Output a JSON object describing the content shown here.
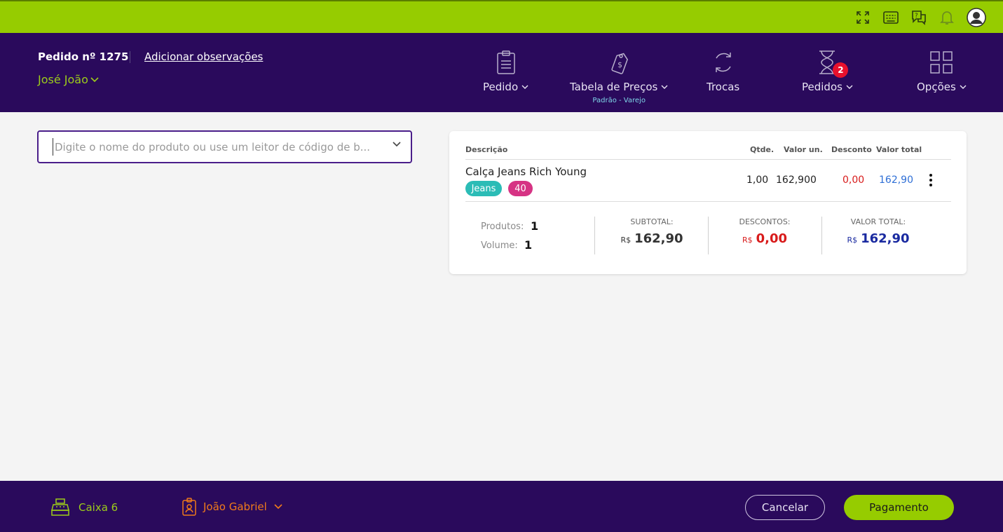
{
  "topbar": {
    "icons": [
      "fullscreen-icon",
      "keyboard-icon",
      "help-chat-icon",
      "bell-icon",
      "user-avatar-icon"
    ]
  },
  "header": {
    "order_number": "Pedido nº 1275",
    "add_notes_link": "Adicionar observações",
    "customer_name": "José João",
    "nav": [
      {
        "label": "Pedido",
        "icon": "clipboard-icon"
      },
      {
        "label": "Tabela de Preços",
        "sublabel": "Padrão - Varejo",
        "icon": "price-tag-icon"
      },
      {
        "label": "Trocas",
        "icon": "exchange-icon"
      },
      {
        "label": "Pedidos",
        "badge": "2",
        "icon": "hourglass-icon"
      },
      {
        "label": "Opções",
        "icon": "grid-icon"
      }
    ]
  },
  "search": {
    "placeholder": "Digite o nome do produto ou use um leitor de código de b...",
    "value": ""
  },
  "cart": {
    "columns": [
      "Descrição",
      "Qtde.",
      "Valor un.",
      "Desconto",
      "Valor total"
    ],
    "items": [
      {
        "description": "Calça Jeans Rich Young",
        "tags": [
          "Jeans",
          "40"
        ],
        "qty": "1,00",
        "unit_price": "162,900",
        "discount": "0,00",
        "total": "162,90"
      }
    ],
    "summary": {
      "products_label": "Produtos:",
      "products_value": "1",
      "volume_label": "Volume:",
      "volume_value": "1",
      "subtotal_label": "SUBTOTAL:",
      "subtotal_currency": "R$",
      "subtotal_value": "162,90",
      "discounts_label": "DESCONTOS:",
      "discounts_currency": "R$",
      "discounts_value": "0,00",
      "total_label": "VALOR TOTAL:",
      "total_currency": "R$",
      "total_value": "162,90"
    }
  },
  "footer": {
    "register": "Caixa 6",
    "seller": "João Gabriel",
    "cancel_label": "Cancelar",
    "pay_label": "Pagamento"
  },
  "colors": {
    "brand_green": "#96cc00",
    "header_purple": "#2a0a5c",
    "tag_teal": "#2bbcb6",
    "tag_pink": "#d63384",
    "discount_red": "#d81b1b",
    "total_blue": "#2f6fd6",
    "badge_red": "#e8112d",
    "seller_orange": "#f07b1a"
  }
}
